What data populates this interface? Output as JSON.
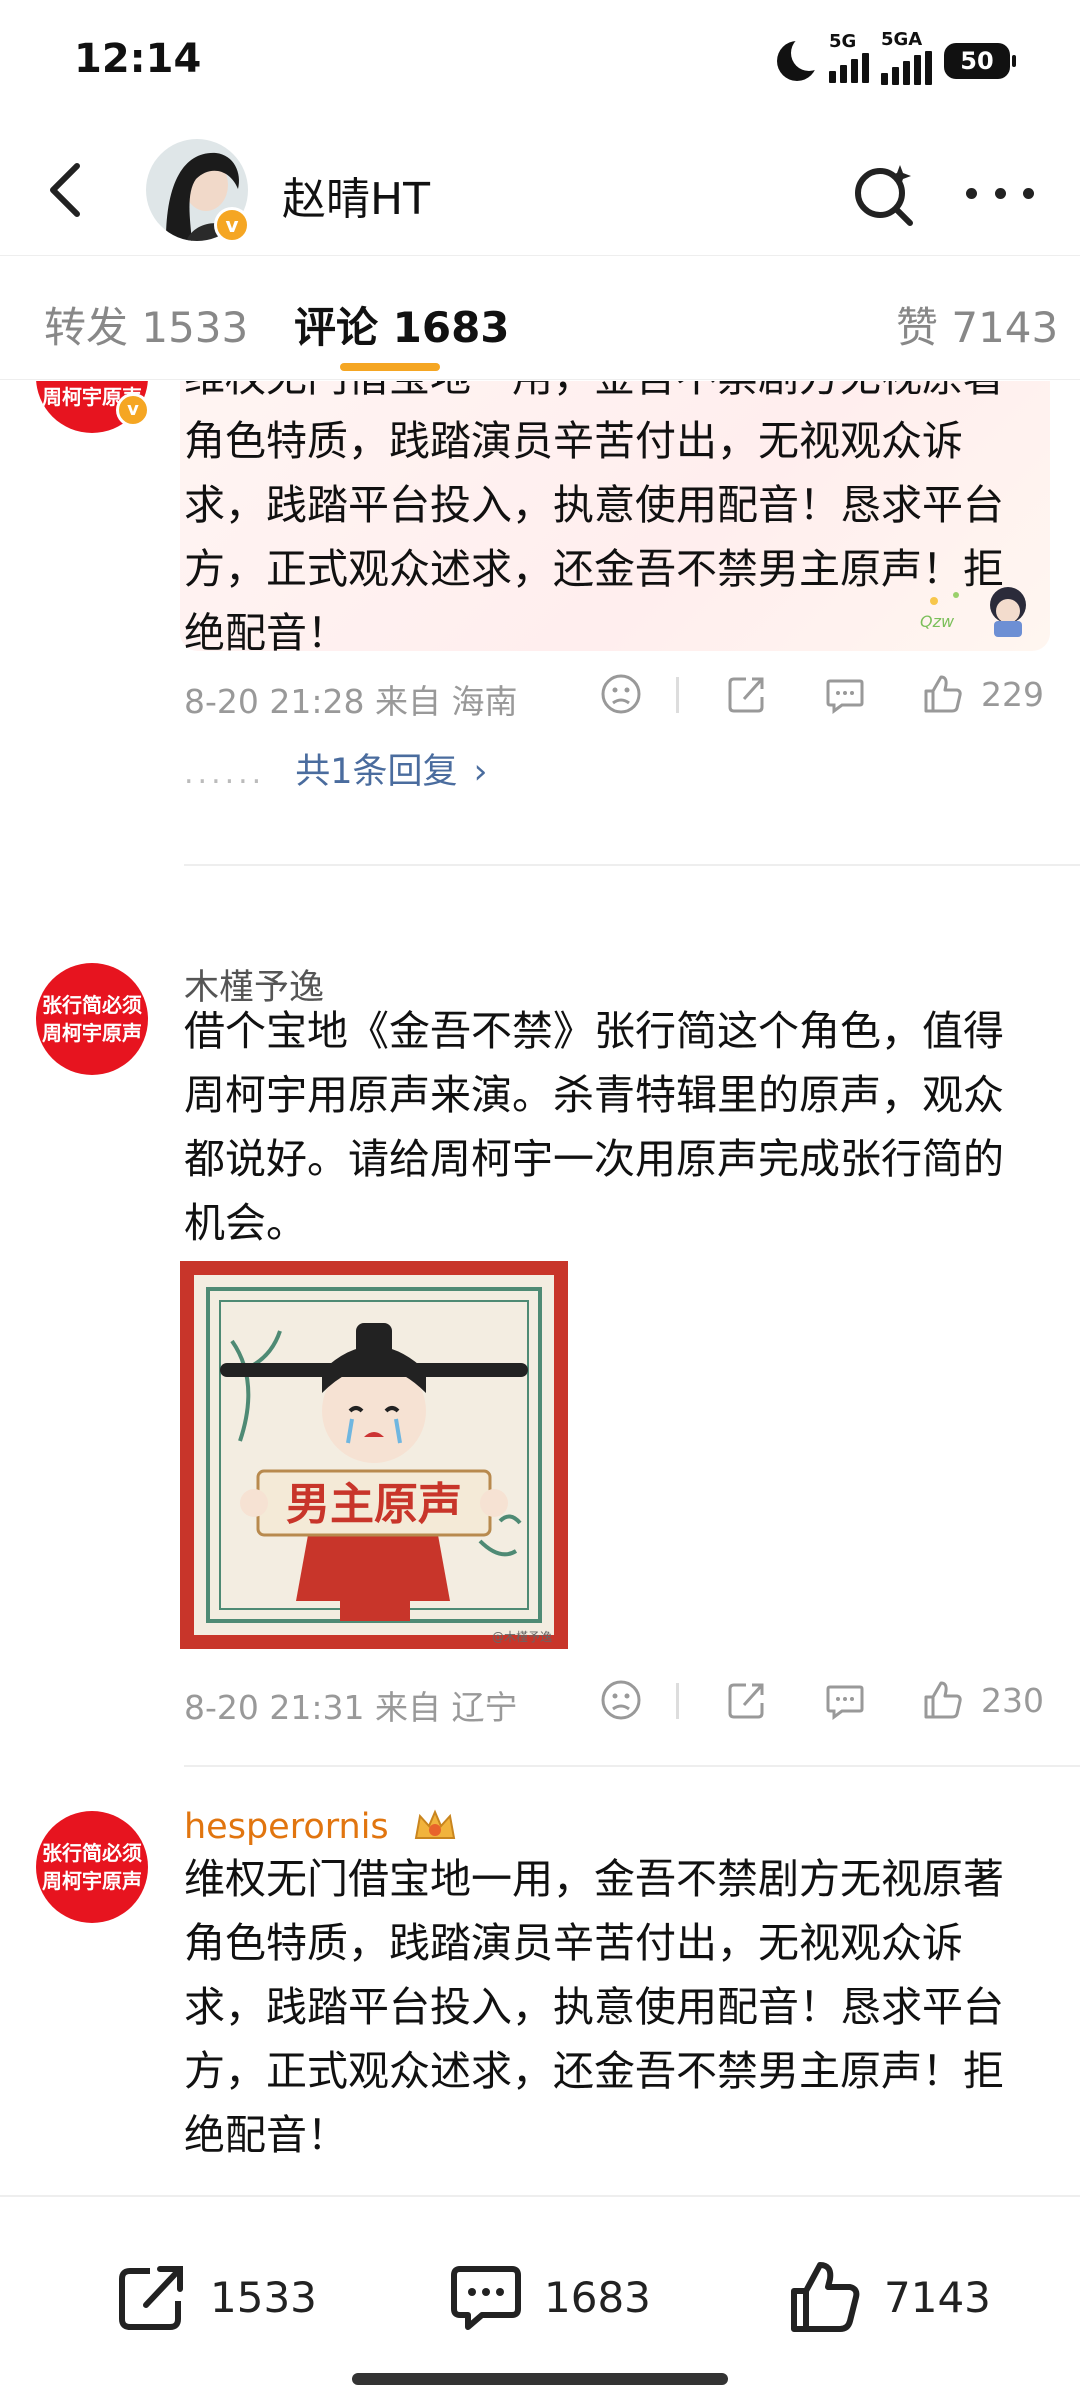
{
  "status": {
    "time": "12:14",
    "net1": "5G",
    "net2": "5GA",
    "battery": "50"
  },
  "header": {
    "user_name": "赵晴HT"
  },
  "tabs": [
    {
      "label": "转发 1533"
    },
    {
      "label": "评论 1683"
    },
    {
      "label": "赞 7143"
    }
  ],
  "comments": [
    {
      "avatar_text": "周柯宇原声",
      "text": "维权无门借宝地一用，金吾不禁剧方无视原著角色特质，践踏演员辛苦付出，无视观众诉求，践踏平台投入，执意使用配音！恳求平台方，正式观众述求，还金吾不禁男主原声！拒绝配音！",
      "time": "8-20 21:28 来自 海南",
      "likes": "229",
      "replies": "共1条回复"
    },
    {
      "avatar_line1": "张行简必须",
      "avatar_line2": "周柯宇原声",
      "user": "木槿予逸",
      "text": "借个宝地《金吾不禁》张行简这个角色，值得周柯宇用原声来演。杀青特辑里的原声，观众都说好。请给周柯宇一次用原声完成张行简的机会。",
      "image_banner": "男主原声",
      "image_watermark": "@木槿予逸",
      "time": "8-20 21:31 来自 辽宁",
      "likes": "230"
    },
    {
      "avatar_line1": "张行简必须",
      "avatar_line2": "周柯宇原声",
      "user": "hesperornis",
      "text": "维权无门借宝地一用，金吾不禁剧方无视原著角色特质，践踏演员辛苦付出，无视观众诉求，践踏平台投入，执意使用配音！恳求平台方，正式观众述求，还金吾不禁男主原声！拒绝配音！"
    }
  ],
  "bottom_bar": {
    "reposts": "1533",
    "comments": "1683",
    "likes": "7143"
  }
}
